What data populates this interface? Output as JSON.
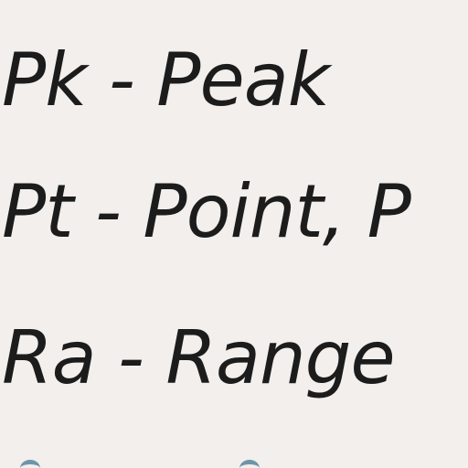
{
  "lines": [
    "Pk - Peak",
    "Pt - Point, P",
    "Ra - Range"
  ],
  "colors": {
    "background": "#f2efec",
    "text": "#1c1c1c",
    "partial_next_line": "#6e95a8"
  }
}
